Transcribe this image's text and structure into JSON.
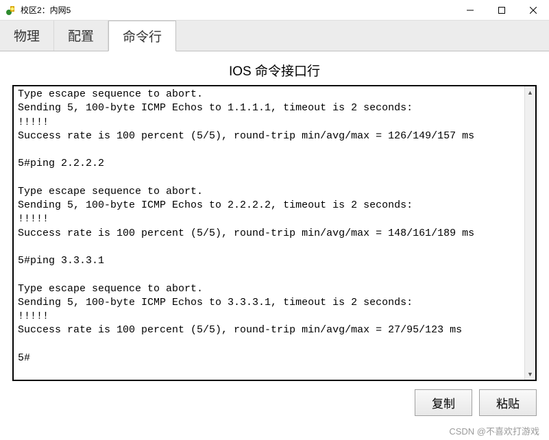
{
  "window": {
    "title": "校区2：内网5"
  },
  "tabs": {
    "physical": "物理",
    "config": "配置",
    "cli": "命令行"
  },
  "panel": {
    "title": "IOS 命令接口行"
  },
  "terminal": {
    "text": "Type escape sequence to abort.\nSending 5, 100-byte ICMP Echos to 1.1.1.1, timeout is 2 seconds:\n!!!!!\nSuccess rate is 100 percent (5/5), round-trip min/avg/max = 126/149/157 ms\n\n5#ping 2.2.2.2\n\nType escape sequence to abort.\nSending 5, 100-byte ICMP Echos to 2.2.2.2, timeout is 2 seconds:\n!!!!!\nSuccess rate is 100 percent (5/5), round-trip min/avg/max = 148/161/189 ms\n\n5#ping 3.3.3.1\n\nType escape sequence to abort.\nSending 5, 100-byte ICMP Echos to 3.3.3.1, timeout is 2 seconds:\n!!!!!\nSuccess rate is 100 percent (5/5), round-trip min/avg/max = 27/95/123 ms\n\n5#"
  },
  "buttons": {
    "copy": "复制",
    "paste": "粘贴"
  },
  "watermark": "CSDN @不喜欢打游戏"
}
